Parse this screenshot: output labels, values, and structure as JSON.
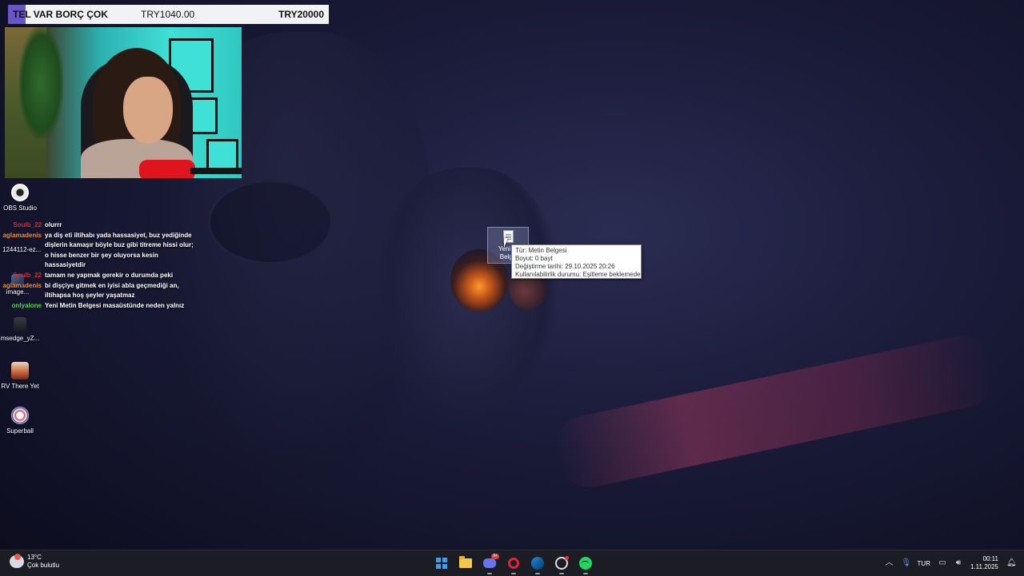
{
  "donation": {
    "name": "TEL VAR BORÇ ÇOK",
    "amount": "TRY1040.00",
    "goal": "TRY20000"
  },
  "desktop_icons": [
    {
      "label": "OBS Studio"
    },
    {
      "label": "1244112-ez..."
    },
    {
      "label": "image..."
    },
    {
      "label": "msedge_yZ..."
    },
    {
      "label": "RV There Yet"
    },
    {
      "label": "Superball"
    }
  ],
  "selected_file": {
    "label_line1": "Yeni M",
    "label_line2": "Belge"
  },
  "tooltip": {
    "type": "Tür: Metin Belgesi",
    "size": "Boyut: 0 bayt",
    "modified": "Değiştirme tarihi: 29.10.2025 20:26",
    "availability": "Kullanılabilirlik durumu: Eşitleme beklemede"
  },
  "chat": [
    {
      "user": "Soulb_22",
      "message": "olurrr",
      "color": "#c1343a"
    },
    {
      "user": "aglamadenis",
      "message": "ya diş eti iltihabı yada hassasiyet, buz yediğinde dişlerin kamaşır böyle buz gibi titreme hissi olur; o hisse benzer bir şey oluyorsa kesin hassasiyetdir",
      "color": "#e88a3a"
    },
    {
      "user": "Soulb_22",
      "message": "tamam ne yapmak gerekir o durumda peki",
      "color": "#c1343a"
    },
    {
      "user": "aglamadenis",
      "message": "bi dişçiye gitmek en iyisi abla geçmediği an, iltihapsa hoş şeyler yaşatmaz",
      "color": "#e88a3a"
    },
    {
      "user": "onlyalone",
      "message": "Yeni Metin Belgesi masaüstünde neden yalnız",
      "color": "#4fd44a"
    }
  ],
  "taskbar": {
    "weather_temp": "13°C",
    "weather_desc": "Çok bulutlu",
    "discord_badge": "9+",
    "language": "TUR",
    "time": "00:11",
    "date": "1.11.2025"
  }
}
